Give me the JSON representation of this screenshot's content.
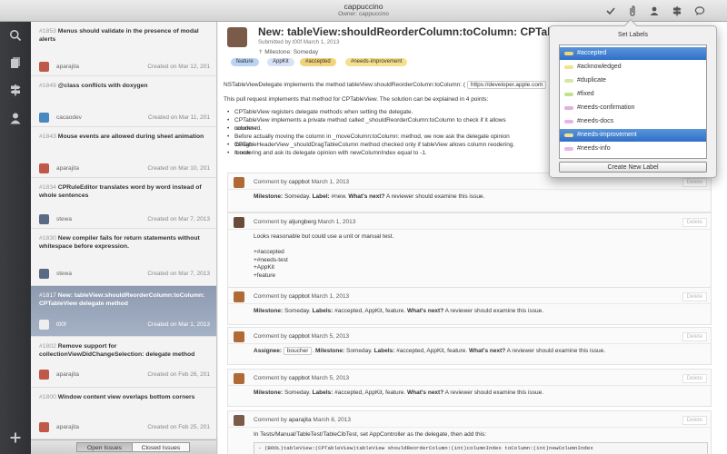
{
  "window": {
    "title": "cappuccino",
    "subtitle": "Owner: cappuccino"
  },
  "toolbar": {
    "icons": [
      "checkmark-icon",
      "paperclip-icon",
      "person-icon",
      "signpost-icon",
      "chat-bubble-icon"
    ]
  },
  "rail": {
    "icons": [
      "search-icon",
      "documents-icon",
      "milestone-icon",
      "user-icon",
      "add-icon"
    ]
  },
  "issues": [
    {
      "num": "#1853",
      "title": "Menus should validate in the presence of modal alerts",
      "author": "aparajita",
      "created": "Created on Mar 12, 201"
    },
    {
      "num": "#1849",
      "title": "@class conflicts with doxygen",
      "author": "cacaodev",
      "created": "Created on Mar 11, 201"
    },
    {
      "num": "#1843",
      "title": "Mouse events are allowed during sheet animation",
      "author": "aparajita",
      "created": "Created on Mar 10, 201"
    },
    {
      "num": "#1834",
      "title": "CPRuleEditor translates word by word instead of whole sentences",
      "author": "stewa",
      "created": "Created on Mar 7, 2013"
    },
    {
      "num": "#1830",
      "title": "New compiler fails for return statements without whitespace before expression.",
      "author": "stewa",
      "created": "Created on Mar 7, 2013"
    },
    {
      "num": "#1817",
      "title": "New: tableView:shouldReorderColumn:toColumn: CPTableView delegate method",
      "author": "t00f",
      "created": "Created on Mar 1, 2013"
    },
    {
      "num": "#1802",
      "title": "Remove support for collectionViewDidChangeSelection: delegate method",
      "author": "aparajita",
      "created": "Created on Feb 26, 201"
    },
    {
      "num": "#1800",
      "title": "Window content view overlaps bottom corners",
      "author": "aparajita",
      "created": "Created on Feb 25, 201"
    }
  ],
  "tabs": {
    "open": "Open Issues",
    "closed": "Closed Issues"
  },
  "detail": {
    "title": "New: tableView:shouldReorderColumn:toColumn: CPTableView dele",
    "submitted": "Submitted by t00f March 1, 2013",
    "milestone": "Milestone: Someday",
    "tags": [
      {
        "name": "feature",
        "color": "#b9d3f2"
      },
      {
        "name": "AppKit",
        "color": "#d7e3f5"
      },
      {
        "name": "#accepted",
        "color": "#f2d27a"
      },
      {
        "name": "#needs-improvement",
        "color": "#f5e08c"
      }
    ],
    "intro": "NSTableViewDelegate implements the method tableView:shouldReorderColumn:toColumn: (",
    "link": "https://developer.apple.com",
    "explain": "This pull request implements that method for CPTableView. The solution can be explained in 4 points:",
    "bullets": [
      "CPTableView registers delegate methods when setting the delegate.",
      "CPTableView implements a private method called _shouldReorderColumn:toColumn to check if it allows column r",
      "reordered.",
      "Before actually moving the column in _moveColumn:toColumn: method, we now ask the delegate opinion though",
      "CPTableHeaderView _shouldDragTableColumn method checked only if tableView allows column reodering. It now",
      "reordering and ask its delegate opinion with newColumnIndex equal to -1."
    ]
  },
  "comments": [
    {
      "author": "cappbot",
      "date": "March 1, 2013",
      "del": "Delete",
      "body": [
        {
          "b": "Milestone:",
          "t": " Someday. "
        },
        {
          "b": "Label:",
          "t": " #new. "
        },
        {
          "b": "What's next?",
          "t": " A reviewer should examine this issue."
        }
      ]
    },
    {
      "author": "aljungberg",
      "date": "March 1, 2013",
      "del": "Delete",
      "text": [
        "Looks reasonable but could use a unit or manual test.",
        "",
        "+#accepted",
        "+#needs-test",
        "+AppKit",
        "+feature"
      ]
    },
    {
      "author": "cappbot",
      "date": "March 1, 2013",
      "del": "Delete",
      "body": [
        {
          "b": "Milestone:",
          "t": " Someday. "
        },
        {
          "b": "Labels:",
          "t": " #accepted, AppKit, feature. "
        },
        {
          "b": "What's next?",
          "t": " A reviewer should examine this issue."
        }
      ]
    },
    {
      "author": "cappbot",
      "date": "March 5, 2013",
      "del": "Delete",
      "assignee_label": "Assignee:",
      "assignee": "boucher",
      "body": [
        {
          "b": "Milestone:",
          "t": " Someday. "
        },
        {
          "b": "Labels:",
          "t": " #accepted, AppKit, feature. "
        },
        {
          "b": "What's next?",
          "t": " A reviewer should examine this issue."
        }
      ]
    },
    {
      "author": "cappbot",
      "date": "March 5, 2013",
      "del": "Delete",
      "body": [
        {
          "b": "Milestone:",
          "t": " Someday. "
        },
        {
          "b": "Labels:",
          "t": " #accepted, AppKit, feature. "
        },
        {
          "b": "What's next?",
          "t": " A reviewer should examine this issue."
        }
      ]
    },
    {
      "author": "aparajita",
      "date": "March 8, 2013",
      "del": "Delete",
      "text": [
        "In Tests/Manual/TableTest/TableCibTest, set AppController as the delegate, then add this:"
      ],
      "code": "- (BOOL)tableView:(CPTableView)tableView shouldReorderColumn:(int)columnIndex toColumn:(int)newColumnIndex"
    }
  ],
  "comment_prefix": "Comment by",
  "popover": {
    "title": "Set Labels",
    "labels": [
      {
        "name": "#accepted",
        "color": "#f2d27a",
        "selected": true
      },
      {
        "name": "#acknowledged",
        "color": "#f5e08c",
        "selected": false
      },
      {
        "name": "#duplicate",
        "color": "#d3e9a3",
        "selected": false
      },
      {
        "name": "#fixed",
        "color": "#bfe38a",
        "selected": false
      },
      {
        "name": "#needs-confirmation",
        "color": "#e0b0e0",
        "selected": false
      },
      {
        "name": "#needs-docs",
        "color": "#e7b5e7",
        "selected": false
      },
      {
        "name": "#needs-improvement",
        "color": "#f5e08c",
        "selected": true
      },
      {
        "name": "#needs-info",
        "color": "#e7b5e7",
        "selected": false
      }
    ],
    "button": "Create New Label"
  },
  "colors": {
    "accent": "#2f6fc8",
    "selection": "#8e9ab0",
    "rail": "#333538"
  }
}
